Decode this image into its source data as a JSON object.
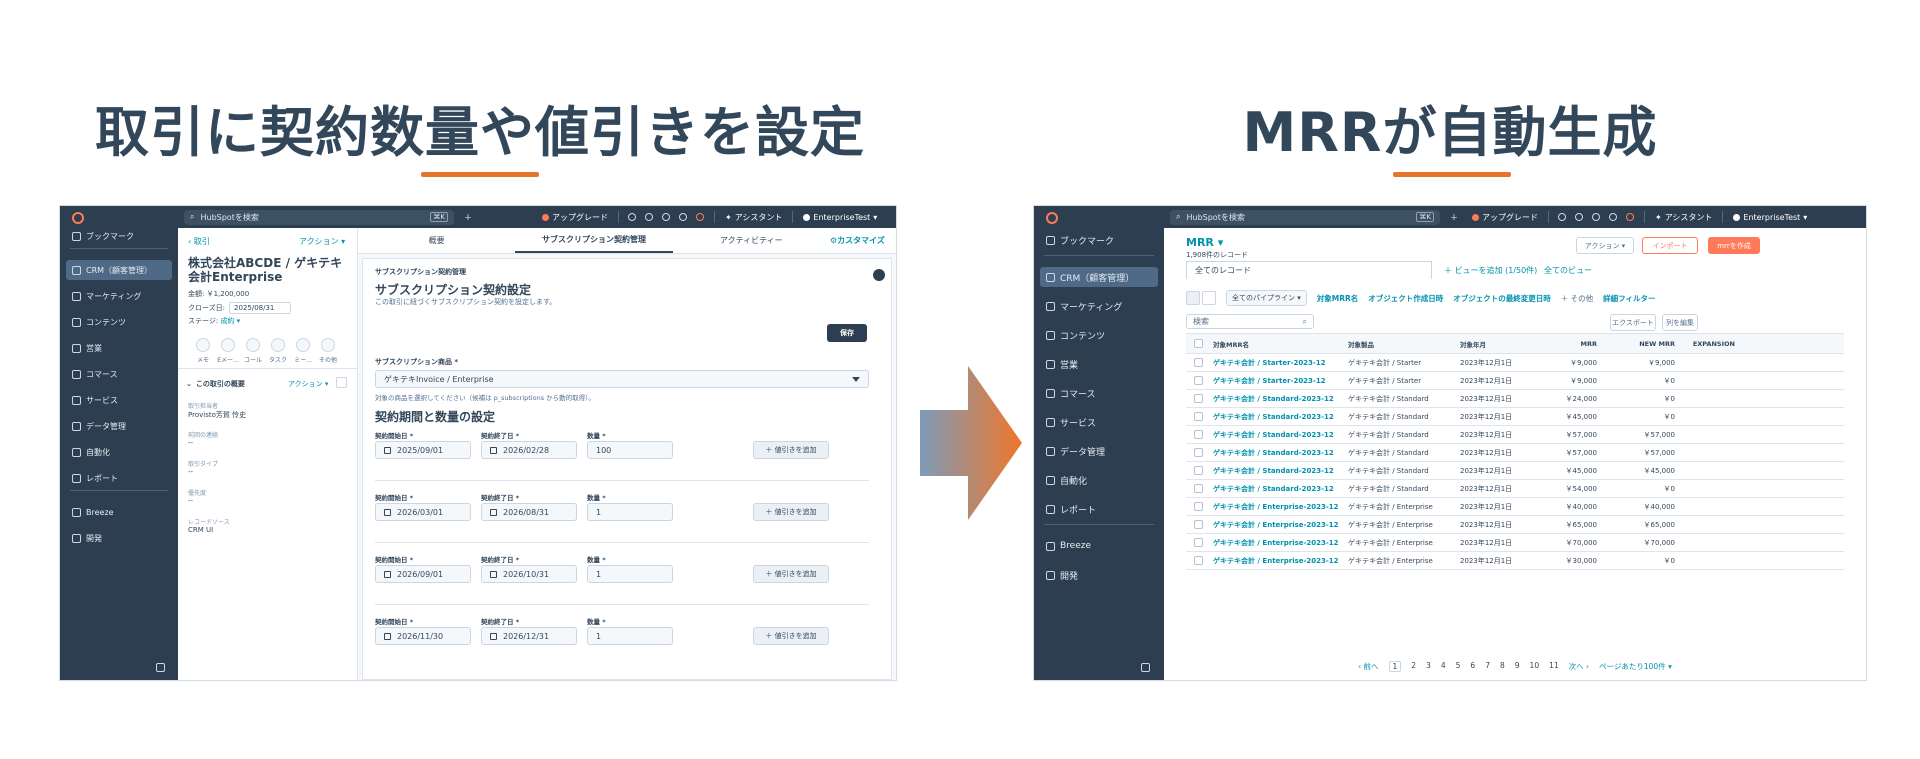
{
  "left_headline": "取引に契約数量や値引きを設定",
  "right_headline": "MRRが自動生成",
  "colors": {
    "accent": "#e8742c",
    "sidebar": "#2d3e50",
    "link": "#0091ae",
    "orange_button": "#ff7a59"
  },
  "left_app": {
    "search_placeholder": "HubSpotを検索",
    "kbd": "⌘K",
    "upgrade": "アップグレード",
    "assistant": "アシスタント",
    "account": "EnterpriseTest",
    "sidebar": [
      "ブックマーク",
      "CRM（顧客管理）",
      "マーケティング",
      "コンテンツ",
      "営業",
      "コマース",
      "サービス",
      "データ管理",
      "自動化",
      "レポート",
      "Breeze",
      "開発"
    ],
    "back": "取引",
    "actions": "アクション",
    "company": "株式会社ABCDE / ゲキテキ会計Enterprise",
    "amount": "金額: ￥1,200,000",
    "close_date_label": "クローズ日:",
    "close_date": "2025/08/31",
    "stage_label": "ステージ:",
    "stage": "成約",
    "quick_actions": [
      "メモ",
      "Eメー...",
      "コール",
      "タスク",
      "ミー...",
      "その他"
    ],
    "summary": "この取引の概要",
    "summary_actions": "アクション",
    "fields": [
      {
        "label": "取引担当者",
        "value": "Provisto芳賀 怜史"
      },
      {
        "label": "前回の連絡",
        "value": "--"
      },
      {
        "label": "取引タイプ",
        "value": "--"
      },
      {
        "label": "優先度",
        "value": "--"
      },
      {
        "label": "レコードソース",
        "value": "CRM UI"
      }
    ],
    "tabs": [
      "概要",
      "サブスクリプション契約管理",
      "アクティビティー"
    ],
    "customize": "カスタマイズ",
    "card_small_title": "サブスクリプション契約管理",
    "card_title": "サブスクリプション契約設定",
    "card_desc": "この取引に紐づくサブスクリプション契約を設定します。",
    "save": "保存",
    "product_label": "サブスクリプション商品 *",
    "product_value": "ゲキテキInvoice / Enterprise",
    "product_help": "対象の商品を選択してください（候補は p_subscriptions から動的取得）。",
    "period_title": "契約期間と数量の設定",
    "start_label": "契約開始日 *",
    "end_label": "契約終了日 *",
    "qty_label": "数量 *",
    "discount_btn": "＋ 値引きを追加",
    "rows": [
      {
        "start": "2025/09/01",
        "end": "2026/02/28",
        "qty": "100"
      },
      {
        "start": "2026/03/01",
        "end": "2026/08/31",
        "qty": "1"
      },
      {
        "start": "2026/09/01",
        "end": "2026/10/31",
        "qty": "1"
      },
      {
        "start": "2026/11/30",
        "end": "2026/12/31",
        "qty": "1"
      }
    ]
  },
  "right_app": {
    "search_placeholder": "HubSpotを検索",
    "upgrade": "アップグレード",
    "assistant": "アシスタント",
    "account": "EnterpriseTest",
    "sidebar": [
      "ブックマーク",
      "CRM（顧客管理）",
      "マーケティング",
      "コンテンツ",
      "営業",
      "コマース",
      "サービス",
      "データ管理",
      "自動化",
      "レポート",
      "Breeze",
      "開発"
    ],
    "title": "MRR",
    "count": "1,908件のレコード",
    "actions": "アクション",
    "import": "インポート",
    "create": "mrrを作成",
    "view_tab": "全てのレコード",
    "add_view": "＋ ビューを追加 (1/50件)",
    "all_views": "全てのビュー",
    "pipeline": "全てのパイプライン",
    "filters": [
      "対象MRR名",
      "オブジェクト作成日時",
      "オブジェクトの最終変更日時",
      "＋ その他",
      "詳細フィルター"
    ],
    "search": "検索",
    "export": "エクスポート",
    "edit_columns": "列を編集",
    "columns": [
      "対象MRR名",
      "対象製品",
      "対象年月",
      "MRR",
      "NEW MRR",
      "EXPANSION"
    ],
    "rows": [
      [
        "ゲキテキ会計 / Starter-2023-12",
        "ゲキテキ会計 / Starter",
        "2023年12月1日",
        "￥9,000",
        "￥9,000"
      ],
      [
        "ゲキテキ会計 / Starter-2023-12",
        "ゲキテキ会計 / Starter",
        "2023年12月1日",
        "￥9,000",
        "￥0"
      ],
      [
        "ゲキテキ会計 / Standard-2023-12",
        "ゲキテキ会計 / Standard",
        "2023年12月1日",
        "￥24,000",
        "￥0"
      ],
      [
        "ゲキテキ会計 / Standard-2023-12",
        "ゲキテキ会計 / Standard",
        "2023年12月1日",
        "￥45,000",
        "￥0"
      ],
      [
        "ゲキテキ会計 / Standard-2023-12",
        "ゲキテキ会計 / Standard",
        "2023年12月1日",
        "￥57,000",
        "￥57,000"
      ],
      [
        "ゲキテキ会計 / Standard-2023-12",
        "ゲキテキ会計 / Standard",
        "2023年12月1日",
        "￥57,000",
        "￥57,000"
      ],
      [
        "ゲキテキ会計 / Standard-2023-12",
        "ゲキテキ会計 / Standard",
        "2023年12月1日",
        "￥45,000",
        "￥45,000"
      ],
      [
        "ゲキテキ会計 / Standard-2023-12",
        "ゲキテキ会計 / Standard",
        "2023年12月1日",
        "￥54,000",
        "￥0"
      ],
      [
        "ゲキテキ会計 / Enterprise-2023-12",
        "ゲキテキ会計 / Enterprise",
        "2023年12月1日",
        "￥40,000",
        "￥40,000"
      ],
      [
        "ゲキテキ会計 / Enterprise-2023-12",
        "ゲキテキ会計 / Enterprise",
        "2023年12月1日",
        "￥65,000",
        "￥65,000"
      ],
      [
        "ゲキテキ会計 / Enterprise-2023-12",
        "ゲキテキ会計 / Enterprise",
        "2023年12月1日",
        "￥70,000",
        "￥70,000"
      ],
      [
        "ゲキテキ会計 / Enterprise-2023-12",
        "ゲキテキ会計 / Enterprise",
        "2023年12月1日",
        "￥30,000",
        "￥0"
      ]
    ],
    "pager": {
      "prev": "前へ",
      "pages": [
        "1",
        "2",
        "3",
        "4",
        "5",
        "6",
        "7",
        "8",
        "9",
        "10",
        "11"
      ],
      "next": "次へ",
      "per_page": "ページあたり100件"
    }
  }
}
